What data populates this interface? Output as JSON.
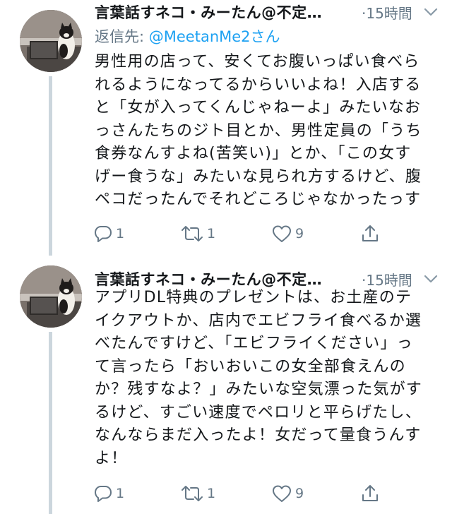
{
  "tweets": [
    {
      "author_name": "言葉話すネコ・みーたん@不定…",
      "timestamp": "·15時間",
      "reply_label": "返信先: ",
      "reply_handle": "@MeetanMe2さん",
      "text": "男性用の店って、安くてお腹いっぱい食べら\nれるようになってるからいいよね！入店する\nと「女が入ってくんじゃねーよ」みたいなお\nっさんたちのジト目とか、男性定員の「うち\n食券なんすよね(苦笑い)」とか、「この女す\nげー食うな」みたいな見られ方するけど、腹\nペコだったんでそれどころじゃなかったっす",
      "reply_count": "1",
      "retweet_count": "1",
      "like_count": "9"
    },
    {
      "author_name": "言葉話すネコ・みーたん@不定…",
      "timestamp": "·15時間",
      "text": "アプリDL特典のプレゼントは、お土産のテ\nイクアウトか、店内でエビフライ食べるか選\nべたんですけど、「エビフライください」っ\nて言ったら「おいおいこの女全部食えんの\nか？残すなよ？」みたいな空気漂った気がす\nるけど、すごい速度でペロリと平らげたし、\nなんならまだ入ったよ！女だって量食うんす\nよ！",
      "reply_count": "1",
      "retweet_count": "1",
      "like_count": "9"
    }
  ],
  "icons": {
    "reply": "reply-icon",
    "retweet": "retweet-icon",
    "like": "heart-icon",
    "share": "share-icon",
    "caret": "chevron-down-icon"
  },
  "colors": {
    "text": "#14171a",
    "muted": "#657786",
    "link": "#1da1f2",
    "thread_line": "#ccd6dd"
  }
}
